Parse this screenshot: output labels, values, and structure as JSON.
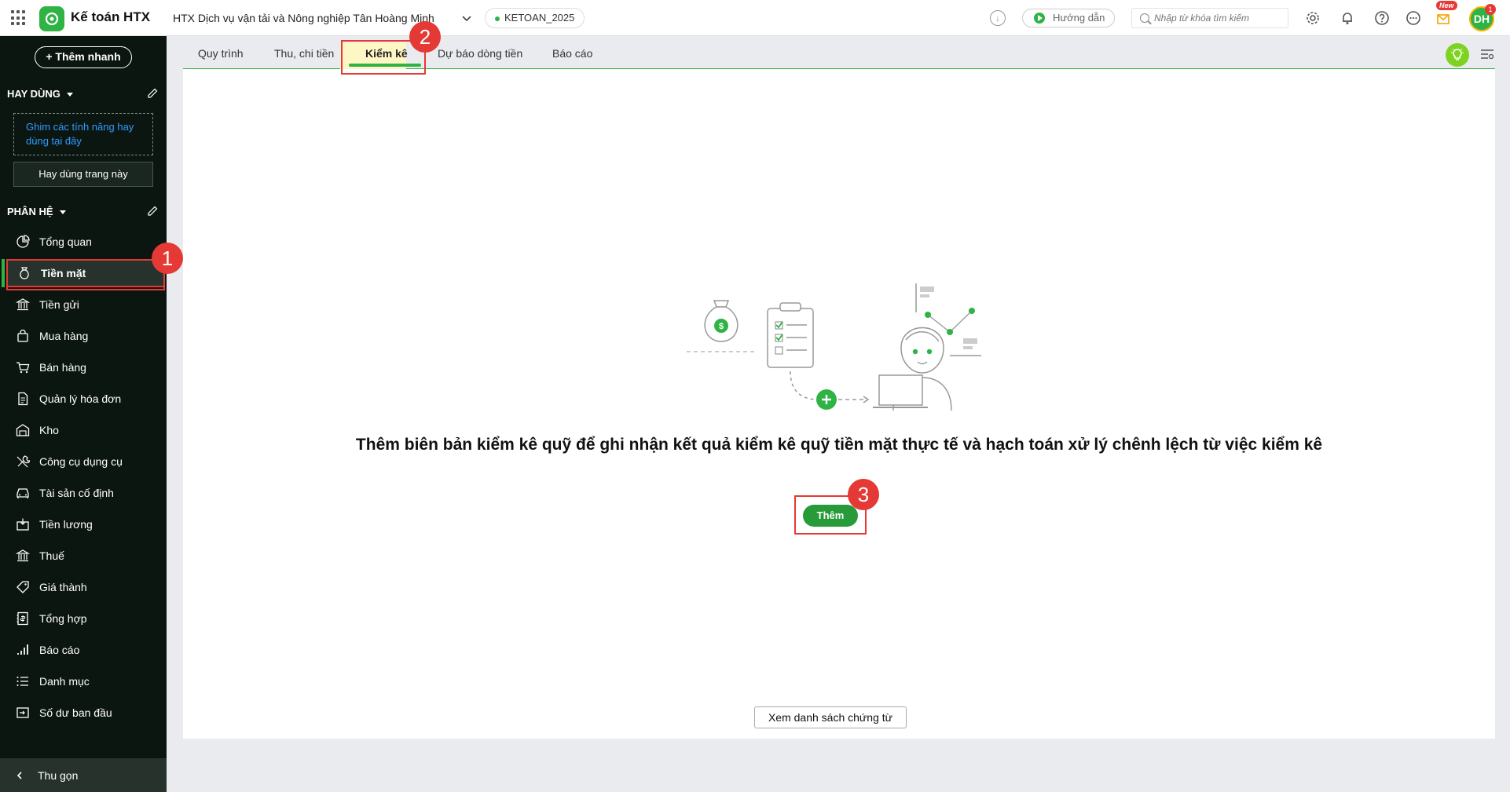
{
  "topbar": {
    "app_title": "Kế toán HTX",
    "org_name": "HTX Dịch vụ vận tải và Nông nghiệp Tân Hoàng Minh",
    "database": "KETOAN_2025",
    "guide_label": "Hướng dẫn",
    "search_placeholder": "Nhập từ khóa tìm kiếm",
    "new_badge": "New",
    "avatar_initials": "DH",
    "avatar_notification_count": "1"
  },
  "sidebar": {
    "quick_add_label": "Thêm nhanh",
    "frequent_header": "HAY DÙNG",
    "pin_hint": "Ghim các tính năng hay dùng tại đây",
    "frequent_page_button": "Hay dùng trang này",
    "modules_header": "PHÂN HỆ",
    "items": [
      {
        "label": "Tổng quan",
        "icon": "chart-pie-icon"
      },
      {
        "label": "Tiền mặt",
        "icon": "money-bag-icon",
        "active": true
      },
      {
        "label": "Tiền gửi",
        "icon": "bank-icon"
      },
      {
        "label": "Mua hàng",
        "icon": "shopping-bag-icon"
      },
      {
        "label": "Bán hàng",
        "icon": "cart-icon"
      },
      {
        "label": "Quản lý hóa đơn",
        "icon": "invoice-icon"
      },
      {
        "label": "Kho",
        "icon": "warehouse-icon"
      },
      {
        "label": "Công cụ dụng cụ",
        "icon": "tools-icon"
      },
      {
        "label": "Tài sản cố định",
        "icon": "car-icon"
      },
      {
        "label": "Tiền lương",
        "icon": "salary-icon"
      },
      {
        "label": "Thuế",
        "icon": "tax-icon"
      },
      {
        "label": "Giá thành",
        "icon": "price-tag-icon"
      },
      {
        "label": "Tổng hợp",
        "icon": "ledger-icon"
      },
      {
        "label": "Báo cáo",
        "icon": "bar-chart-icon"
      },
      {
        "label": "Danh mục",
        "icon": "list-icon"
      },
      {
        "label": "Số dư ban đầu",
        "icon": "opening-balance-icon"
      }
    ],
    "collapse_label": "Thu gọn"
  },
  "tabs": [
    {
      "label": "Quy trình"
    },
    {
      "label": "Thu, chi tiền"
    },
    {
      "label": "Kiểm kê",
      "active": true
    },
    {
      "label": "Dự báo dòng tiền"
    },
    {
      "label": "Báo cáo"
    }
  ],
  "main": {
    "message": "Thêm biên bản kiểm kê quỹ để ghi nhận kết quả kiểm kê quỹ tiền mặt thực tế và hạch toán xử lý chênh lệch từ việc kiểm kê",
    "add_button": "Thêm",
    "view_list_button": "Xem danh sách chứng từ"
  },
  "annotations": [
    "1",
    "2",
    "3"
  ],
  "colors": {
    "brand_green": "#2fb344",
    "sidebar_bg": "#0c1611",
    "annotation_red": "#e53935",
    "active_tab_bg": "#fff6c6"
  }
}
